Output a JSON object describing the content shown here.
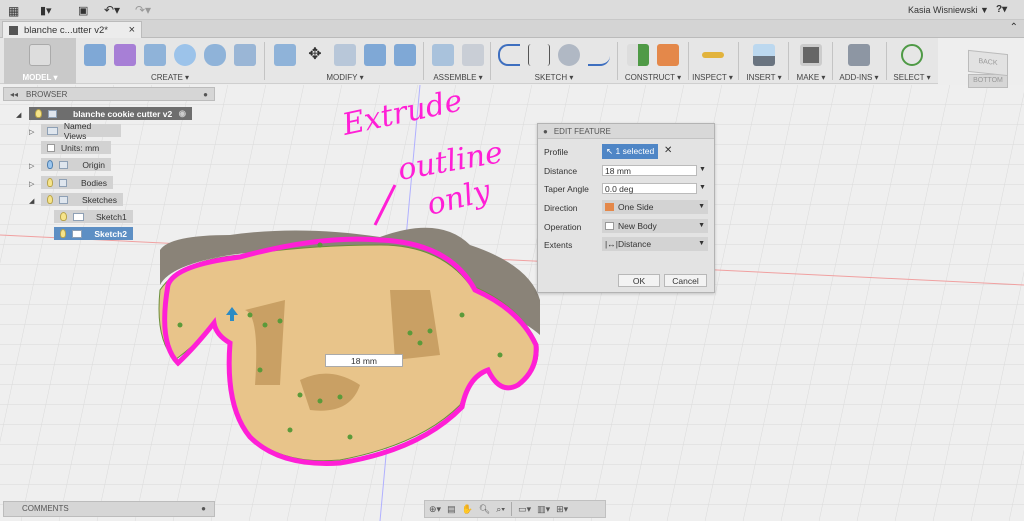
{
  "topbar": {
    "user": "Kasia Wisniewski ▼",
    "help": "?▾",
    "icons": [
      "grid-icon",
      "file-icon",
      "save-icon",
      "undo-icon",
      "redo-icon"
    ]
  },
  "tab": {
    "title": "blanche c...utter v2*",
    "close": "×"
  },
  "toolbar": {
    "groups": [
      {
        "label": "MODEL ▾"
      },
      {
        "label": "CREATE ▾"
      },
      {
        "label": "MODIFY ▾"
      },
      {
        "label": "ASSEMBLE ▾"
      },
      {
        "label": "SKETCH ▾"
      },
      {
        "label": "CONSTRUCT ▾"
      },
      {
        "label": "INSPECT ▾"
      },
      {
        "label": "INSERT ▾"
      },
      {
        "label": "MAKE ▾"
      },
      {
        "label": "ADD-INS ▾"
      },
      {
        "label": "SELECT ▾"
      }
    ]
  },
  "viewcube": {
    "back": "BACK",
    "bottom": "BOTTOM"
  },
  "browser": {
    "title": "BROWSER",
    "root": "blanche cookie cutter v2",
    "items": [
      "Named Views",
      "Units: mm",
      "Origin",
      "Bodies",
      "Sketches",
      "Sketch1",
      "Sketch2"
    ]
  },
  "dialog": {
    "title": "EDIT FEATURE",
    "profile_label": "Profile",
    "profile_value": "1 selected",
    "distance_label": "Distance",
    "distance_value": "18 mm",
    "taper_label": "Taper Angle",
    "taper_value": "0.0 deg",
    "direction_label": "Direction",
    "direction_value": "One Side",
    "operation_label": "Operation",
    "operation_value": "New Body",
    "extents_label": "Extents",
    "extents_value": "Distance",
    "ok": "OK",
    "cancel": "Cancel"
  },
  "viewport": {
    "distance_input": "18 mm",
    "annotation": [
      "Extrude",
      "outline",
      "only"
    ],
    "annotation_color": "#ff1fd6",
    "body_color": "#e8c48a"
  },
  "comments": {
    "title": "COMMENTS"
  }
}
